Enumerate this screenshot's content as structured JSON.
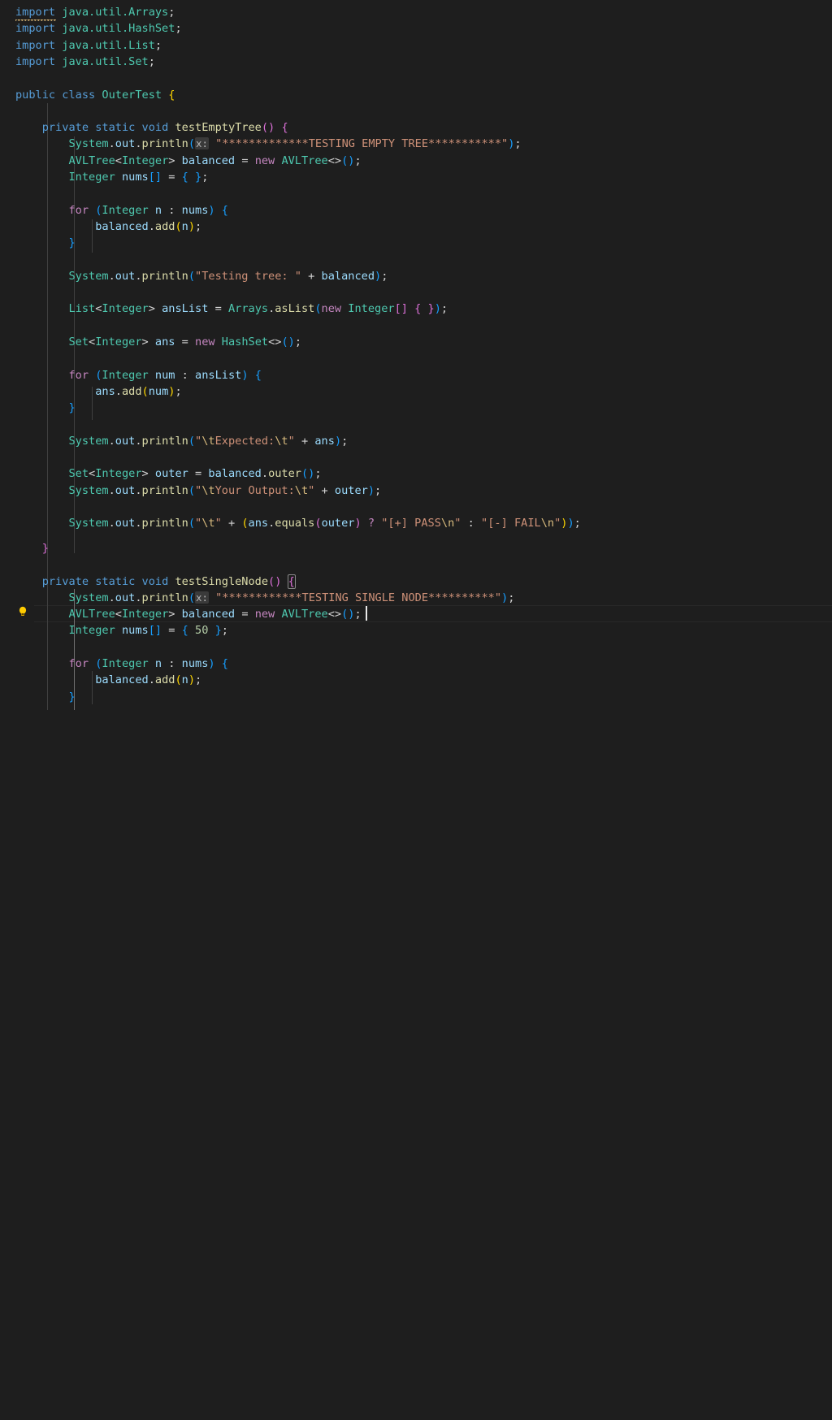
{
  "editor": {
    "language": "java",
    "theme": "Dark Modern",
    "background": "#1e1e1e",
    "font_size_px": 13.6,
    "line_height_px": 20.3
  },
  "gutter": {
    "lightbulb_icon": "lightbulb-quickfix-icon",
    "lightbulb_color": "#ffcc00",
    "lightbulb_line_index": 35
  },
  "cursor": {
    "line_index": 35,
    "after_text": "AVLTree<>();"
  },
  "colors": {
    "keyword": "#569cd6",
    "keyword_control": "#c586c0",
    "type": "#4ec9b0",
    "variable": "#9cdcfe",
    "function": "#dcdcaa",
    "string": "#ce9178",
    "escape": "#d7ba7d",
    "number": "#b5cea8",
    "operator": "#d4d4d4",
    "bracket_gold": "#ffd700",
    "bracket_magenta": "#da70d6",
    "bracket_blue": "#179fff",
    "inlay_hint_bg": "#3a3a3a",
    "current_line_border": "#282828",
    "indent_guide": "#404040",
    "indent_guide_active": "#707070",
    "warning_squiggle": "#e5c07b"
  },
  "inlay_hints": [
    {
      "label": "x:",
      "line_index": 4
    },
    {
      "label": "x:",
      "line_index": 34
    }
  ],
  "code_lines": [
    {
      "n": 0,
      "text": "import java.util.Arrays;"
    },
    {
      "n": 1,
      "text": "import java.util.HashSet;"
    },
    {
      "n": 2,
      "text": "import java.util.List;"
    },
    {
      "n": 3,
      "text": "import java.util.Set;"
    },
    {
      "n": 4,
      "text": ""
    },
    {
      "n": 5,
      "text": "public class OuterTest {"
    },
    {
      "n": 6,
      "text": ""
    },
    {
      "n": 7,
      "text": "    private static void testEmptyTree() {"
    },
    {
      "n": 8,
      "text": "        System.out.println(x: \"*************TESTING EMPTY TREE***********\");"
    },
    {
      "n": 9,
      "text": "        AVLTree<Integer> balanced = new AVLTree<>();"
    },
    {
      "n": 10,
      "text": "        Integer nums[] = { };"
    },
    {
      "n": 11,
      "text": ""
    },
    {
      "n": 12,
      "text": "        for (Integer n : nums) {"
    },
    {
      "n": 13,
      "text": "            balanced.add(n);"
    },
    {
      "n": 14,
      "text": "        }"
    },
    {
      "n": 15,
      "text": ""
    },
    {
      "n": 16,
      "text": "        System.out.println(\"Testing tree: \" + balanced);"
    },
    {
      "n": 17,
      "text": ""
    },
    {
      "n": 18,
      "text": "        List<Integer> ansList = Arrays.asList(new Integer[] { });"
    },
    {
      "n": 19,
      "text": ""
    },
    {
      "n": 20,
      "text": "        Set<Integer> ans = new HashSet<>();"
    },
    {
      "n": 21,
      "text": ""
    },
    {
      "n": 22,
      "text": "        for (Integer num : ansList) {"
    },
    {
      "n": 23,
      "text": "            ans.add(num);"
    },
    {
      "n": 24,
      "text": "        }"
    },
    {
      "n": 25,
      "text": ""
    },
    {
      "n": 26,
      "text": "        System.out.println(\"\\tExpected:\\t\" + ans);"
    },
    {
      "n": 27,
      "text": ""
    },
    {
      "n": 28,
      "text": "        Set<Integer> outer = balanced.outer();"
    },
    {
      "n": 29,
      "text": "        System.out.println(\"\\tYour Output:\\t\" + outer);"
    },
    {
      "n": 30,
      "text": ""
    },
    {
      "n": 31,
      "text": "        System.out.println(\"\\t\" + (ans.equals(outer) ? \"[+] PASS\\n\" : \"[-] FAIL\\n\"));"
    },
    {
      "n": 32,
      "text": "    }"
    },
    {
      "n": 33,
      "text": ""
    },
    {
      "n": 34,
      "text": "    private static void testSingleNode() {"
    },
    {
      "n": 35,
      "text": "        System.out.println(x: \"************TESTING SINGLE NODE**********\");"
    },
    {
      "n": 36,
      "text": "        AVLTree<Integer> balanced = new AVLTree<>();"
    },
    {
      "n": 37,
      "text": "        Integer nums[] = { 50 };"
    },
    {
      "n": 38,
      "text": ""
    },
    {
      "n": 39,
      "text": "        for (Integer n : nums) {"
    },
    {
      "n": 40,
      "text": "            balanced.add(n);"
    },
    {
      "n": 41,
      "text": "        }"
    }
  ],
  "strings": {
    "testing_empty_tree": "*************TESTING EMPTY TREE***********",
    "testing_single_node": "************TESTING SINGLE NODE**********",
    "testing_tree": "Testing tree: ",
    "expected": "\\tExpected:\\t",
    "your_output": "\\tYour Output:\\t",
    "pass": "[+] PASS\\n",
    "fail": "[-] FAIL\\n"
  },
  "identifiers": {
    "class_name": "OuterTest",
    "methods": [
      "testEmptyTree",
      "testSingleNode"
    ],
    "types": [
      "AVLTree",
      "Integer",
      "List",
      "Set",
      "HashSet",
      "Arrays",
      "System"
    ],
    "variables": [
      "balanced",
      "nums",
      "n",
      "ansList",
      "ans",
      "num",
      "outer",
      "out"
    ],
    "package_imports": [
      "java.util.Arrays",
      "java.util.HashSet",
      "java.util.List",
      "java.util.Set"
    ],
    "number_literal": "50"
  }
}
